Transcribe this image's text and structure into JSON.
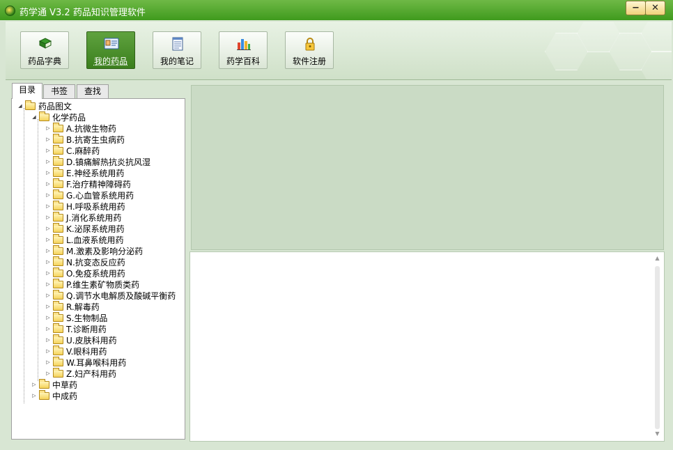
{
  "window": {
    "title": "药学通 V3.2 药品知识管理软件",
    "minimize_symbol": "−",
    "close_symbol": "✕"
  },
  "toolbar": {
    "buttons": [
      {
        "label": "药品字典",
        "icon": "book-icon",
        "active": false
      },
      {
        "label": "我的药品",
        "icon": "id-card-icon",
        "active": true
      },
      {
        "label": "我的笔记",
        "icon": "notepad-icon",
        "active": false
      },
      {
        "label": "药学百科",
        "icon": "flask-icon",
        "active": false
      },
      {
        "label": "软件注册",
        "icon": "lock-icon",
        "active": false
      }
    ]
  },
  "sidebar": {
    "tabs": [
      {
        "label": "目录",
        "active": true
      },
      {
        "label": "书签",
        "active": false
      },
      {
        "label": "查找",
        "active": false
      }
    ],
    "tree": {
      "root": "药品图文",
      "chemical": {
        "label": "化学药品",
        "children": [
          "A.抗微生物药",
          "B.抗寄生虫病药",
          "C.麻醉药",
          "D.镇痛解热抗炎抗风湿",
          "E.神经系统用药",
          "F.治疗精神障碍药",
          "G.心血管系统用药",
          "H.呼吸系统用药",
          "J.消化系统用药",
          "K.泌尿系统用药",
          "L.血液系统用药",
          "M.激素及影响分泌药",
          "N.抗变态反应药",
          "O.免疫系统用药",
          "P.维生素矿物质类药",
          "Q.调节水电解质及酸碱平衡药",
          "R.解毒药",
          "S.生物制品",
          "T.诊断用药",
          "U.皮肤科用药",
          "V.眼科用药",
          "W.耳鼻喉科用药",
          "Z.妇产科用药"
        ]
      },
      "herbal": "中草药",
      "patent": "中成药"
    }
  },
  "colors": {
    "title_green": "#4ea52a",
    "active_button_green": "#4c9130",
    "panel_background": "#d8e6d3",
    "viewer_background": "#cadbc5"
  }
}
